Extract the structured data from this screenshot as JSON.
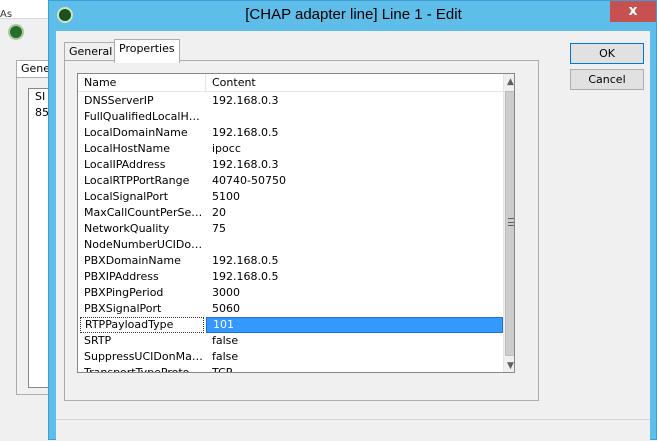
{
  "background_window": {
    "title_stub": "As",
    "tab_label": "Gene",
    "list_lines": [
      "SI",
      "85"
    ]
  },
  "dialog": {
    "title": "[CHAP adapter line] Line 1 - Edit",
    "close_glyph": "x",
    "tabs": [
      {
        "label": "General",
        "active": false
      },
      {
        "label": "Properties",
        "active": true
      }
    ],
    "buttons": {
      "ok": "OK",
      "cancel": "Cancel"
    },
    "grid": {
      "columns": [
        "Name",
        "Content"
      ],
      "selected_row": 14,
      "rows": [
        {
          "name": "DNSServerIP",
          "content": "192.168.0.3"
        },
        {
          "name": "FullQualifiedLocalHos…",
          "content": ""
        },
        {
          "name": "LocalDomainName",
          "content": "192.168.0.5"
        },
        {
          "name": "LocalHostName",
          "content": "ipocc"
        },
        {
          "name": "LocalIPAddress",
          "content": "192.168.0.3"
        },
        {
          "name": "LocalRTPPortRange",
          "content": "40740-50750"
        },
        {
          "name": "LocalSignalPort",
          "content": "5100"
        },
        {
          "name": "MaxCallCountPerSec…",
          "content": "20"
        },
        {
          "name": "NetworkQuality",
          "content": "75"
        },
        {
          "name": "NodeNumberUCIDon…",
          "content": ""
        },
        {
          "name": "PBXDomainName",
          "content": "192.168.0.5"
        },
        {
          "name": "PBXIPAddress",
          "content": "192.168.0.5"
        },
        {
          "name": "PBXPingPeriod",
          "content": "3000"
        },
        {
          "name": "PBXSignalPort",
          "content": "5060"
        },
        {
          "name": "RTPPayloadType",
          "content": "101"
        },
        {
          "name": "SRTP",
          "content": "false"
        },
        {
          "name": "SuppressUCIDonMak…",
          "content": "false"
        },
        {
          "name": "TransportTypeProtocol",
          "content": "TCP"
        }
      ]
    }
  }
}
